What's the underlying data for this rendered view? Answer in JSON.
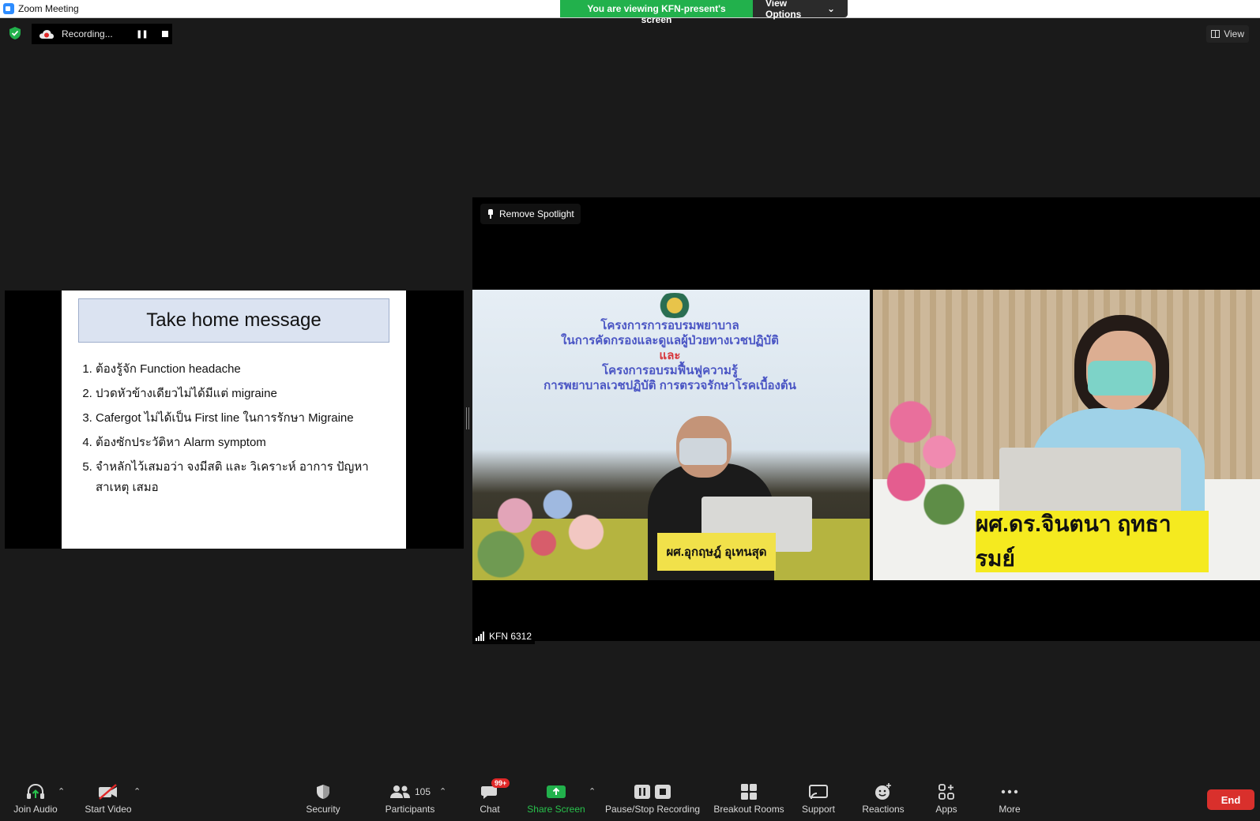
{
  "window": {
    "title": "Zoom Meeting"
  },
  "banner": {
    "message": "You are viewing KFN-present's screen",
    "view_options": "View Options"
  },
  "recording": {
    "label": "Recording..."
  },
  "view_button": {
    "label": "View"
  },
  "slide": {
    "title": "Take home message",
    "items": [
      "ต้องรู้จัก Function headache",
      "ปวดหัวข้างเดียวไม่ได้มีแต่ migraine",
      "Cafergot ไม่ได้เป็น First line ในการรักษา Migraine",
      "ต้องซักประวัติหา Alarm symptom",
      "จำหลักไว้เสมอว่า จงมีสติ และ วิเคราะห์ อาการ ปัญหา สาเหตุ เสมอ"
    ]
  },
  "video": {
    "remove_spotlight": "Remove Spotlight",
    "participant_name": "KFN 6312",
    "backdrop_lines": [
      "โครงการการอบรมพยาบาล",
      "ในการคัดกรองและดูแลผู้ป่วยทางเวชปฏิบัติ",
      "และ",
      "โครงการอบรมฟื้นฟูความรู้",
      "การพยาบาลเวชปฏิบัติ การตรวจรักษาโรคเบื้องต้น"
    ],
    "nameplate_left": "ผศ.อุกฤษฎ์ อุเทนสุด",
    "nameplate_right": "ผศ.ดร.จินตนา ฤทธารมย์"
  },
  "toolbar": {
    "join_audio": "Join Audio",
    "start_video": "Start Video",
    "security": "Security",
    "participants": "Participants",
    "participants_count": "105",
    "chat": "Chat",
    "chat_badge": "99+",
    "share_screen": "Share Screen",
    "pause_stop_recording": "Pause/Stop Recording",
    "breakout_rooms": "Breakout Rooms",
    "support": "Support",
    "reactions": "Reactions",
    "apps": "Apps",
    "more": "More",
    "end": "End"
  },
  "colors": {
    "share_green": "#22b14c",
    "end_red": "#d9302c",
    "badge_red": "#e02828"
  }
}
